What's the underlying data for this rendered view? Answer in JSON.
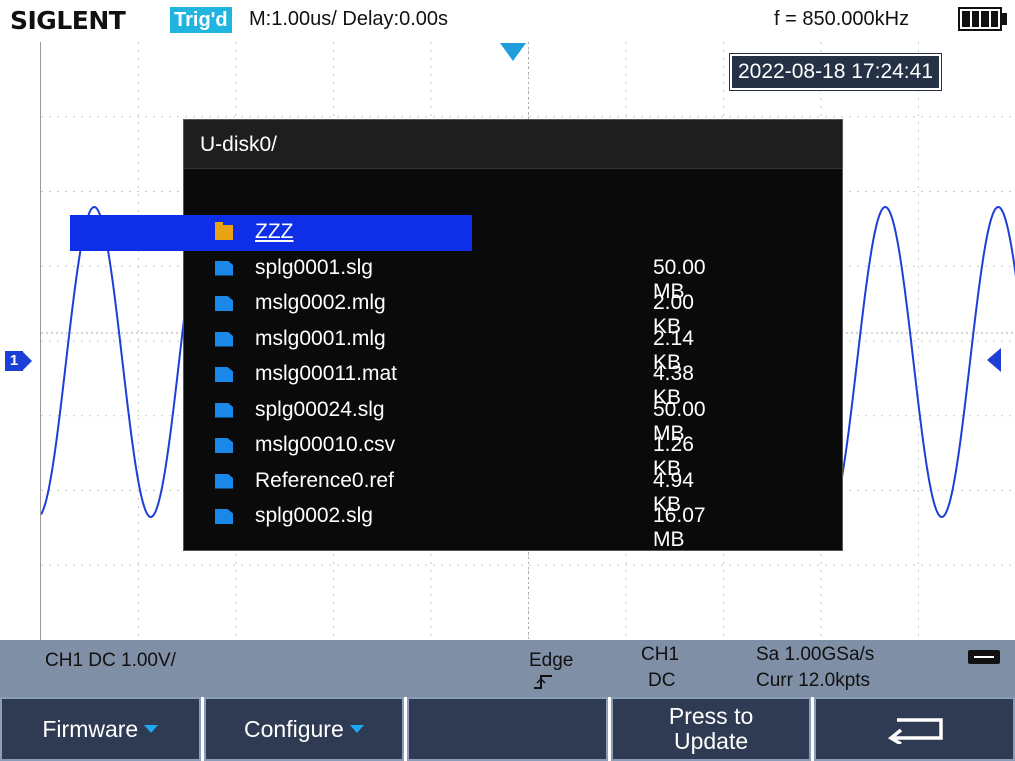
{
  "header": {
    "brand": "SIGLENT",
    "trig_status": "Trig'd",
    "timebase": "M:1.00us/ Delay:0.00s",
    "frequency": "f = 850.000kHz",
    "battery_icon": "battery-full-icon"
  },
  "screen": {
    "datetime": "2022-08-18 17:24:41",
    "channel_marker": "1",
    "trace_color": "#1c3fd6"
  },
  "file_dialog": {
    "path": "U-disk0/",
    "selected_index": 0,
    "items": [
      {
        "type": "folder",
        "icon": "folder-icon",
        "name": "ZZZ",
        "size": ""
      },
      {
        "type": "file",
        "icon": "file-icon",
        "name": "splg0001.slg",
        "size": "50.00 MB"
      },
      {
        "type": "file",
        "icon": "file-icon",
        "name": "mslg0002.mlg",
        "size": "2.00 KB"
      },
      {
        "type": "file",
        "icon": "file-icon",
        "name": "mslg0001.mlg",
        "size": "2.14 KB"
      },
      {
        "type": "file",
        "icon": "file-icon",
        "name": "mslg00011.mat",
        "size": "4.38 KB"
      },
      {
        "type": "file",
        "icon": "file-icon",
        "name": "splg00024.slg",
        "size": "50.00 MB"
      },
      {
        "type": "file",
        "icon": "file-icon",
        "name": "mslg00010.csv",
        "size": "1.26 KB"
      },
      {
        "type": "file",
        "icon": "file-icon",
        "name": "Reference0.ref",
        "size": "4.94 KB"
      },
      {
        "type": "file",
        "icon": "file-icon",
        "name": "splg0002.slg",
        "size": "16.07 MB"
      }
    ]
  },
  "status_bar": {
    "channel": "CH1 DC 1.00V/",
    "trigger_type": "Edge",
    "trigger_source": "CH1",
    "trigger_coupling": "DC",
    "sample_rate": "Sa 1.00GSa/s",
    "memory": "Curr 12.0kpts",
    "usb_icon": "usb-icon"
  },
  "softkeys": {
    "firmware": "Firmware",
    "configure": "Configure",
    "press_to": "Press to",
    "update": "Update",
    "back_icon": "back-arrow-icon"
  }
}
